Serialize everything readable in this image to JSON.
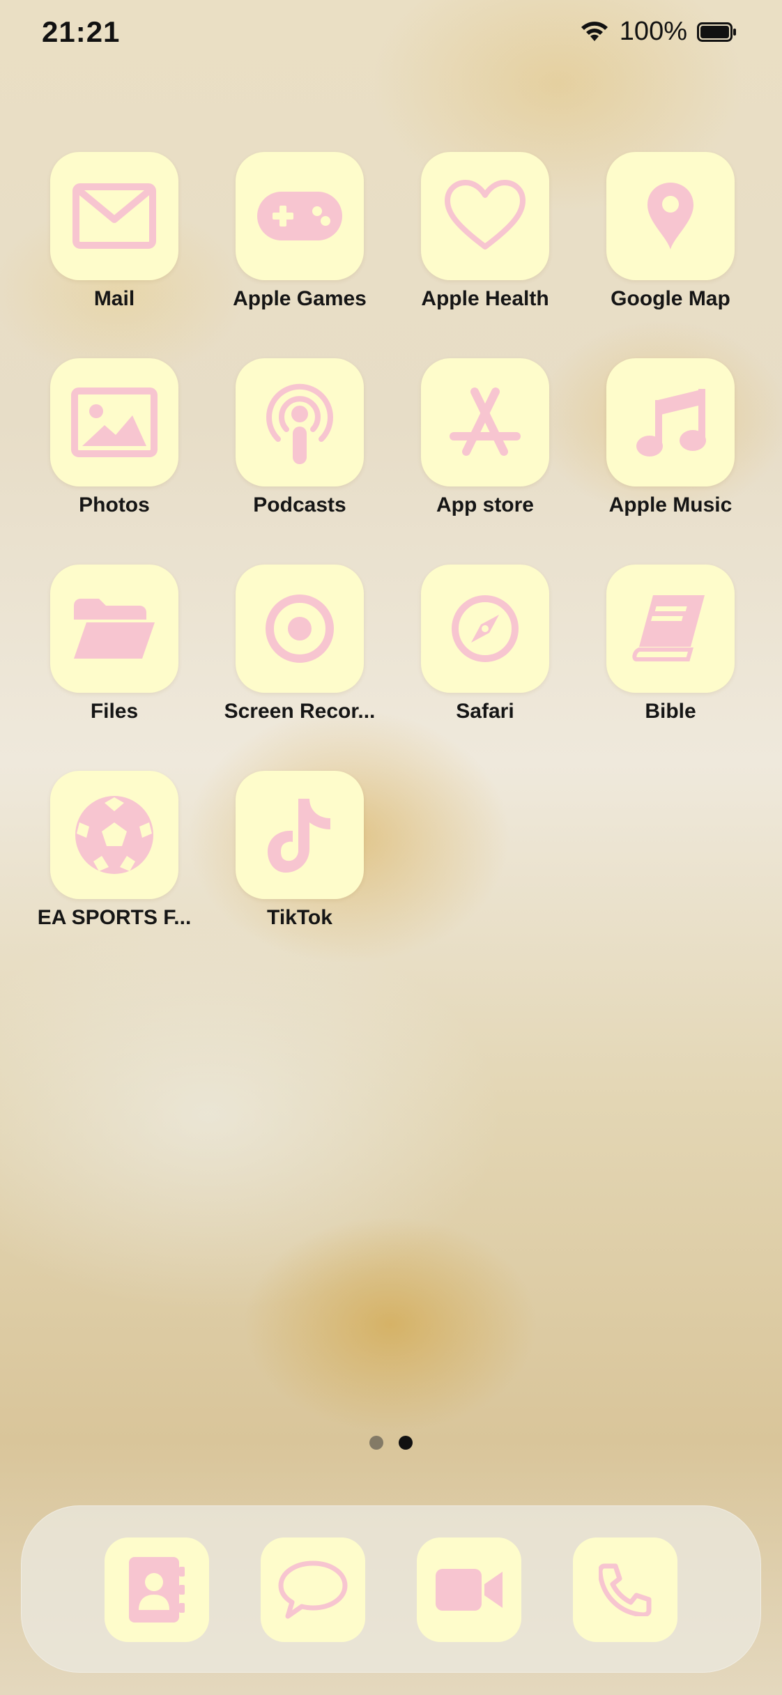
{
  "status_bar": {
    "time": "21:21",
    "battery_percent": "100%",
    "wifi_icon": "wifi-icon",
    "battery_icon": "battery-full-icon"
  },
  "theme": {
    "icon_background": "#fefccb",
    "glyph_color": "#f7c5d0"
  },
  "apps": [
    {
      "label": "Mail",
      "icon": "mail-icon"
    },
    {
      "label": "Apple Games",
      "icon": "gamepad-icon"
    },
    {
      "label": "Apple Health",
      "icon": "heart-icon"
    },
    {
      "label": "Google Map",
      "icon": "map-pin-icon"
    },
    {
      "label": "Photos",
      "icon": "photo-icon"
    },
    {
      "label": "Podcasts",
      "icon": "podcast-icon"
    },
    {
      "label": "App store",
      "icon": "app-store-icon"
    },
    {
      "label": "Apple Music",
      "icon": "music-note-icon"
    },
    {
      "label": "Files",
      "icon": "folder-icon"
    },
    {
      "label": "Screen Recor...",
      "icon": "record-icon"
    },
    {
      "label": "Safari",
      "icon": "compass-icon"
    },
    {
      "label": "Bible",
      "icon": "book-icon"
    },
    {
      "label": "EA SPORTS F...",
      "icon": "soccer-ball-icon"
    },
    {
      "label": "TikTok",
      "icon": "tiktok-icon"
    }
  ],
  "page_indicator": {
    "pages": 2,
    "current": 2
  },
  "dock": [
    {
      "icon": "contacts-icon"
    },
    {
      "icon": "message-icon"
    },
    {
      "icon": "video-camera-icon"
    },
    {
      "icon": "phone-icon"
    }
  ]
}
